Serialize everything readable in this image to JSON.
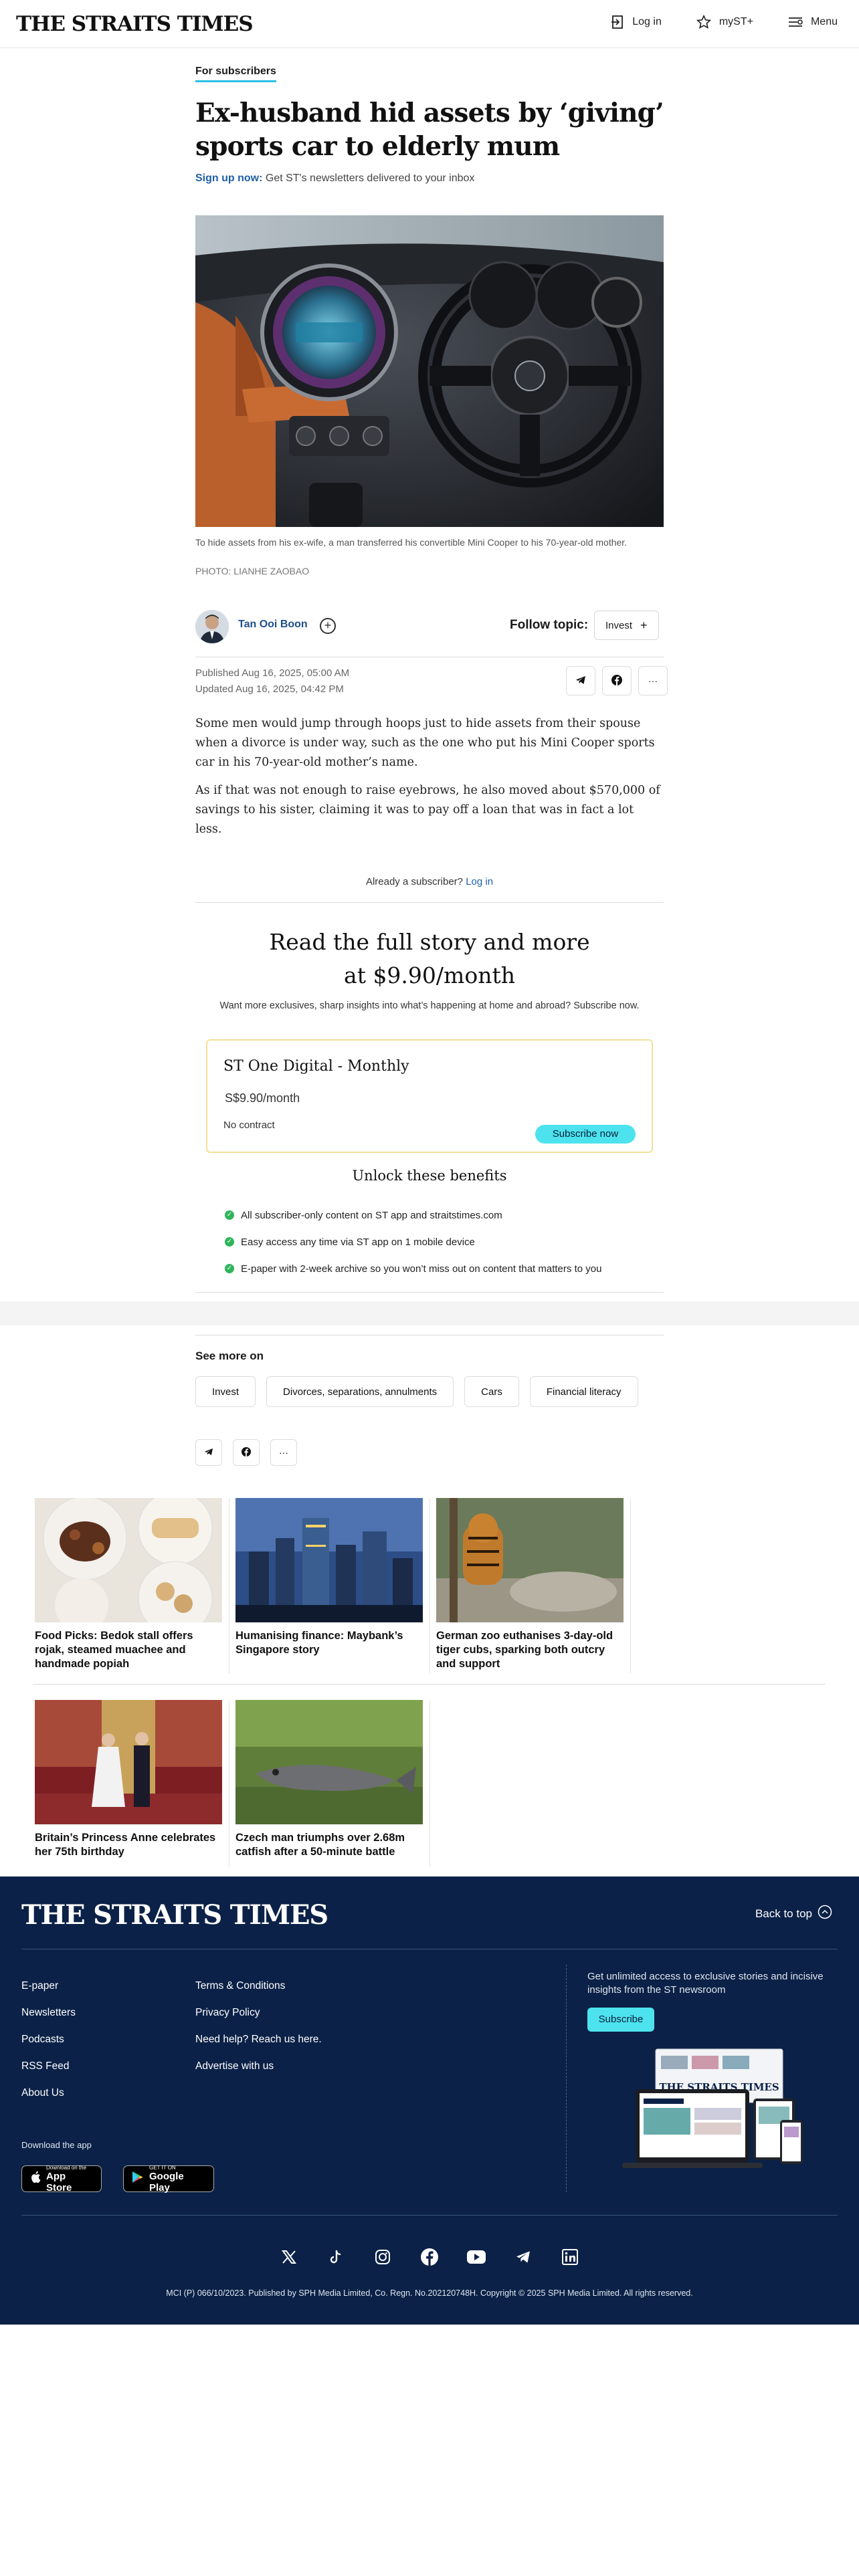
{
  "header": {
    "logo": "THE STRAITS TIMES",
    "login_label": "Log in",
    "myst_label": "myST+",
    "menu_label": "Menu"
  },
  "article": {
    "kicker": "For subscribers",
    "headline": "Ex-husband hid assets by ‘giving’ sports car to elderly mum",
    "signup_link": "Sign up now:",
    "signup_text": " Get ST's newsletters delivered to your inbox",
    "caption": "To hide assets from his ex-wife, a man transferred his convertible Mini Cooper to his 70-year-old mother.",
    "credit": "PHOTO: LIANHE ZAOBAO",
    "author": "Tan Ooi Boon",
    "follow_label": "Follow topic:",
    "follow_topic": "Invest",
    "published": "Published Aug 16, 2025, 05:00 AM",
    "updated": "Updated Aug 16, 2025, 04:42 PM",
    "paragraphs": [
      "Some men would jump through hoops just to hide assets from their spouse when a divorce is under way, such as the one who put his Mini Cooper sports car in his 70-year-old mother’s name.",
      "As if that was not enough to raise eyebrows, he also moved about $570,000 of savings to his sister, claiming it was to pay off a loan that was in fact a lot less."
    ]
  },
  "paywall": {
    "already_text": "Already a subscriber?",
    "login_link": "Log in",
    "title": "Read the full story and more at $9.90/month",
    "subtitle": "Want more exclusives, sharp insights into what’s happening at home and abroad? Subscribe now.",
    "plan_name": "ST One Digital - Monthly",
    "plan_price": "S$9.90/month",
    "no_contract": "No contract",
    "subscribe_label": "Subscribe now",
    "unlock_title": "Unlock these benefits",
    "benefits": [
      "All subscriber-only content on ST app and straitstimes.com",
      "Easy access any time via ST app on 1 mobile device",
      "E-paper with 2-week archive so you won’t miss out on content that matters to you"
    ]
  },
  "see_more": {
    "title": "See more on",
    "tags": [
      "Invest",
      "Divorces, separations, annulments",
      "Cars",
      "Financial literacy"
    ]
  },
  "related": [
    "Food Picks: Bedok stall offers rojak, steamed muachee and handmade popiah",
    "Humanising finance: Maybank’s Singapore story",
    "German zoo euthanises 3-day-old tiger cubs, sparking both outcry and support",
    "Britain’s Princess Anne celebrates her 75th birthday",
    "Czech man triumphs over 2.68m catfish after a 50-minute battle"
  ],
  "footer": {
    "logo": "THE STRAITS TIMES",
    "back_to_top": "Back to top",
    "col1": [
      "E-paper",
      "Newsletters",
      "Podcasts",
      "RSS Feed",
      "About Us"
    ],
    "col2": [
      "Terms & Conditions",
      "Privacy Policy",
      "Need help? Reach us here.",
      "Advertise with us"
    ],
    "cta": "Get unlimited access to exclusive stories and incisive insights from the ST newsroom",
    "subscribe_label": "Subscribe",
    "download_label": "Download the app",
    "appstore_small": "Download on the",
    "appstore_big": "App Store",
    "googleplay_small": "GET IT ON",
    "googleplay_big": "Google Play",
    "copyright": "MCI (P) 066/10/2023. Published by SPH Media Limited, Co. Regn. No.202120748H. Copyright © 2025 SPH Media Limited. All rights reserved."
  },
  "icons": [
    "login-icon",
    "star-icon",
    "menu-icon",
    "telegram-icon",
    "facebook-icon",
    "more-icon",
    "x-icon",
    "tiktok-icon",
    "instagram-icon",
    "youtube-icon",
    "linkedin-icon"
  ],
  "colors": {
    "accent_cyan": "#4de3ee",
    "footer_navy": "#0b2147",
    "link_blue": "#1f5fa6"
  }
}
